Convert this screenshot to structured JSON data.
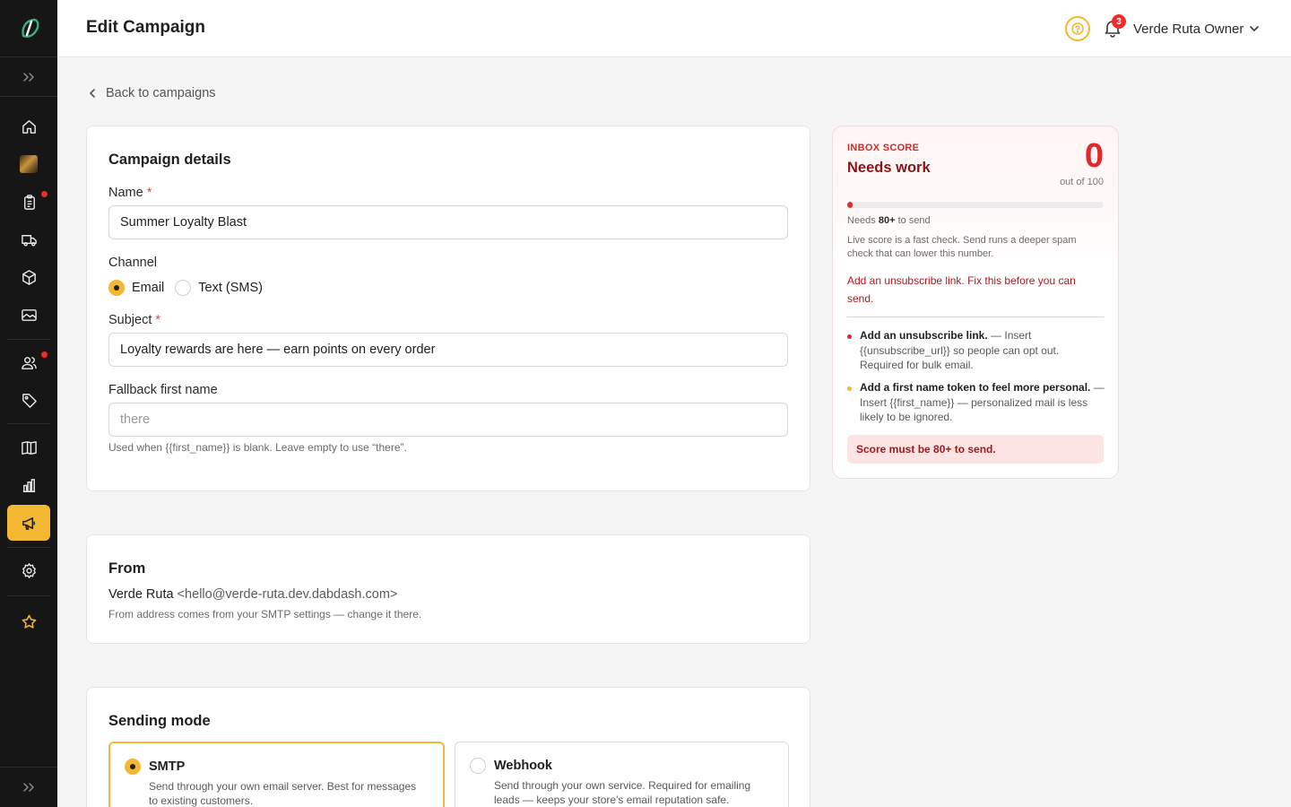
{
  "app": {
    "page_title": "Edit Campaign",
    "accent_color": "#f3b731",
    "danger_color": "#e0282e"
  },
  "header": {
    "notification_count": "3",
    "user_name": "Verde Ruta Owner"
  },
  "sidebar": {
    "items": [
      {
        "icon": "home-icon"
      },
      {
        "icon": "store-thumbnail"
      },
      {
        "icon": "clipboard-icon",
        "dot": true
      },
      {
        "icon": "truck-icon"
      },
      {
        "icon": "box-icon"
      },
      {
        "icon": "image-icon"
      },
      {
        "icon": "users-icon",
        "dot": true
      },
      {
        "icon": "tag-icon"
      },
      {
        "icon": "book-icon"
      },
      {
        "icon": "bar-chart-icon"
      },
      {
        "icon": "megaphone-icon",
        "active": true
      },
      {
        "icon": "gear-icon"
      },
      {
        "icon": "star-icon"
      }
    ]
  },
  "back_link": "Back to campaigns",
  "campaign_details": {
    "title": "Campaign details",
    "name_label": "Name",
    "name_value": "Summer Loyalty Blast",
    "channel_label": "Channel",
    "channel_options": [
      "Email",
      "Text (SMS)"
    ],
    "channel_selected": "Email",
    "subject_label": "Subject",
    "subject_value": "Loyalty rewards are here — earn points on every order",
    "fallback_label": "Fallback first name",
    "fallback_placeholder": "there",
    "fallback_help": "Used when {{first_name}} is blank. Leave empty to use “there”.",
    "required_mark": "*"
  },
  "from": {
    "title": "From",
    "sender_name": "Verde Ruta",
    "sender_email": "<hello@verde-ruta.dev.dabdash.com>",
    "help": "From address comes from your SMTP settings — change it there."
  },
  "sending_mode": {
    "title": "Sending mode",
    "options": [
      {
        "label": "SMTP",
        "desc": "Send through your own email server. Best for messages to existing customers.",
        "selected": true
      },
      {
        "label": "Webhook",
        "desc": "Send through your own service. Required for emailing leads — keeps your store's email reputation safe.",
        "selected": false
      }
    ]
  },
  "inbox_score": {
    "kicker": "INBOX SCORE",
    "status": "Needs work",
    "score": "0",
    "score_fraction": 0,
    "out_of": "out of 100",
    "needs_prefix": "Needs ",
    "needs_value": "80+",
    "needs_suffix": " to send",
    "note": "Live score is a fast check. Send runs a deeper spam check that can lower this number.",
    "alert": "Add an unsubscribe link. Fix this before you can send.",
    "issues": [
      {
        "title": "Add an unsubscribe link.",
        "detail": " — Insert {{unsubscribe_url}} so people can opt out. Required for bulk email.",
        "severity_color": "#e0282e"
      },
      {
        "title": "Add a first name token to feel more personal.",
        "detail": " — Insert {{first_name}} — personalized mail is less likely to be ignored.",
        "severity_color": "#f3b731"
      }
    ],
    "footer": "Score must be 80+ to send."
  }
}
